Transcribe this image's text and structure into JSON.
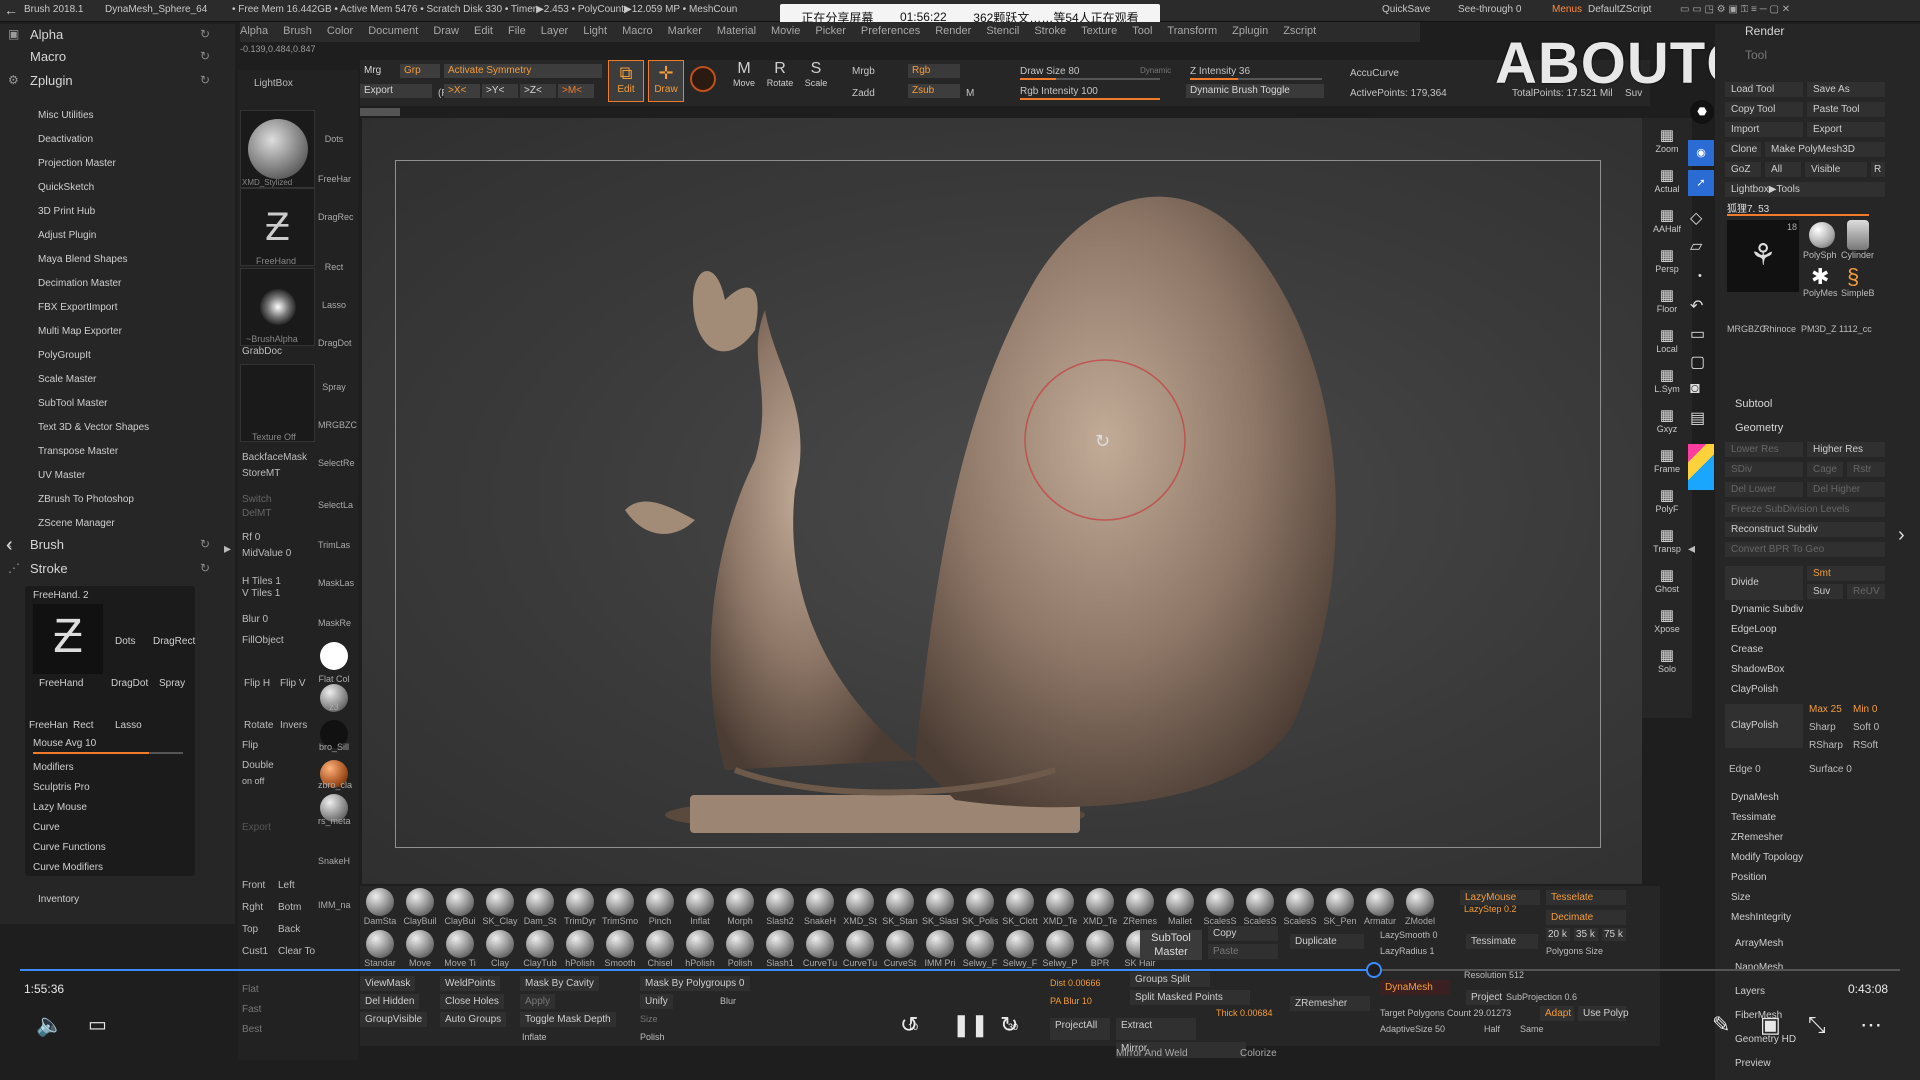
{
  "titlebar": {
    "app": "Brush 2018.1",
    "doc": "DynaMesh_Sphere_64",
    "freemem": "• Free Mem 16.442GB • Active Mem 5476 • Scratch Disk 330 • Timer▶2.453 • PolyCount▶12.059 MP • MeshCoun",
    "quicksave": "QuickSave",
    "seethrough": "See-through  0",
    "menus": "Menus",
    "defaultzscript": "DefaultZScript"
  },
  "share": {
    "label": "正在分享屏幕",
    "time": "01:56:22",
    "viewers": "362颗跃文……等54人正在观看"
  },
  "watermark": "ABOUTCG.ORG",
  "menu": [
    "Alpha",
    "Brush",
    "Color",
    "Document",
    "Draw",
    "Edit",
    "File",
    "Layer",
    "Light",
    "Macro",
    "Marker",
    "Material",
    "Movie",
    "Picker",
    "Preferences",
    "Render",
    "Stencil",
    "Stroke",
    "Texture",
    "Tool",
    "Transform",
    "Zplugin",
    "Zscript"
  ],
  "coords": "-0.139,0.484,0.847",
  "left": {
    "alpha": "Alpha",
    "macro": "Macro",
    "zplugin": "Zplugin",
    "plugins": [
      "Misc Utilities",
      "Deactivation",
      "Projection Master",
      "QuickSketch",
      "3D Print Hub",
      "Adjust Plugin",
      "Maya Blend Shapes",
      "Decimation Master",
      "FBX ExportImport",
      "Multi Map Exporter",
      "PolyGroupIt",
      "Scale Master",
      "SubTool Master",
      "Text 3D & Vector Shapes",
      "Transpose Master",
      "UV Master",
      "ZBrush To Photoshop",
      "ZScene Manager"
    ],
    "brush": "Brush",
    "stroke": "Stroke",
    "freehand": "FreeHand. 2",
    "freehand_lbl": "FreeHand",
    "dots": "Dots",
    "dragrect": "DragRect",
    "dragdot": "DragDot",
    "spray": "Spray",
    "freehan2": "FreeHan",
    "rect": "Rect",
    "lasso": "Lasso",
    "mouseavg": "Mouse Avg  10",
    "stroke_items": [
      "Modifiers",
      "Sculptris Pro",
      "Lazy Mouse",
      "Curve",
      "Curve Functions",
      "Curve Modifiers"
    ],
    "inventory": "Inventory"
  },
  "toolcol": {
    "lightbox": "LightBox",
    "xmd": "XMD_Stylized",
    "freehand": "FreeHand",
    "brushalpha": "~BrushAlpha",
    "grabdoc": "GrabDoc",
    "textureoff": "Texture Off",
    "backfacemask": "BackfaceMask",
    "storemt": "StoreMT",
    "switch": "Switch",
    "delmt": "DelMT",
    "rf": "Rf 0",
    "midvalue": "MidValue 0",
    "htiles": "H Tiles 1",
    "vtiles": "V Tiles 1",
    "blur": "Blur 0",
    "fillobject": "FillObject",
    "fliph": "Flip H",
    "flipv": "Flip V",
    "rotate": "Rotate",
    "invers": "Invers",
    "flip": "Flip",
    "double": "Double",
    "onoff": "on  off",
    "export": "Export",
    "front": "Front",
    "left": "Left",
    "rght": "Rght",
    "botm": "Botm",
    "top": "Top",
    "back": "Back",
    "cust1": "Cust1",
    "clearto": "Clear To",
    "flat": "Flat",
    "fast": "Fast",
    "best": "Best",
    "dots": "Dots",
    "freehar": "FreeHar",
    "dragrect": "DragRec",
    "rect": "Rect",
    "lasso": "Lasso",
    "dragdot": "DragDot",
    "spray": "Spray",
    "mrgbz": "MRGBZC",
    "selectre": "SelectRe",
    "selectla": "SelectLa",
    "trimlas": "TrimLas",
    "masklas": "MaskLas",
    "maskre": "MaskRe",
    "flatcol": "Flat Col",
    "z3": "z3",
    "brosill": "bro_Sill",
    "zbrocla": "zbro_cla",
    "rsmeta": "rs_meta",
    "snakeh": "SnakeH",
    "immna": "IMM_na"
  },
  "topbar": {
    "mrg": "Mrg",
    "grp": "Grp",
    "activate_symmetry": "Activate Symmetry",
    "export": "Export",
    "r": "(R)",
    "x": ">X<",
    "y": ">Y<",
    "z": ">Z<",
    "m": ">M<",
    "edit": "Edit",
    "draw": "Draw",
    "move": "Move",
    "rotate": "Rotate",
    "scale": "Scale",
    "mrgb": "Mrgb",
    "rgb": "Rgb",
    "zadd": "Zadd",
    "zsub": "Zsub",
    "m2": "M",
    "drawsize": "Draw Size 80",
    "dynamic": "Dynamic",
    "zintensity": "Z Intensity 36",
    "rgbintensity": "Rgb Intensity 100",
    "dynamic_brush": "Dynamic Brush Toggle",
    "accucurve": "AccuCurve",
    "activepoints": "ActivePoints: 179,364",
    "totalpoints": "TotalPoints: 17.521 Mil",
    "suv": "Suv"
  },
  "rightstrip": [
    "Zoom",
    "Actual",
    "AAHalf",
    "Persp",
    "Floor",
    "Local",
    "L.Sym",
    "Gxyz",
    "Frame",
    "PolyF",
    "Transp",
    "Ghost",
    "Xpose",
    "Solo"
  ],
  "right": {
    "render": "Render",
    "tool": "Tool",
    "loadtool": "Load Tool",
    "saveas": "Save As",
    "copytool": "Copy Tool",
    "pastetool": "Paste Tool",
    "import": "Import",
    "export": "Export",
    "clone": "Clone",
    "makepoly": "Make PolyMesh3D",
    "goz": "GoZ",
    "all": "All",
    "visible": "Visible",
    "r": "R",
    "lightbox_tools": "Lightbox▶Tools",
    "model": "狐狸7. 53",
    "num18": "18",
    "polysph": "PolySph",
    "cylinder": "Cylinder",
    "polymes": "PolyMes",
    "simpleb": "SimpleB",
    "mrgbz": "MRGBZC",
    "rhinoce": "Rhinoce",
    "pm3d": "PM3D_Z",
    "itm1112": "1112_cc",
    "subtool": "Subtool",
    "geometry": "Geometry",
    "lowerres": "Lower Res",
    "higherres": "Higher Res",
    "sdiv": "SDiv",
    "cage": "Cage",
    "rstr": "Rstr",
    "dellower": "Del Lower",
    "delhigher": "Del Higher",
    "freeze": "Freeze SubDivision Levels",
    "reconstruct": "Reconstruct Subdiv",
    "convert": "Convert BPR To Geo",
    "divide": "Divide",
    "smt": "Smt",
    "suv": "Suv",
    "reuv": "ReUV",
    "items": [
      "Dynamic Subdiv",
      "EdgeLoop",
      "Crease",
      "ShadowBox",
      "ClayPolish"
    ],
    "claypolish": "ClayPolish",
    "max": "Max 25",
    "min": "Min 0",
    "sharp": "Sharp",
    "soft": "Soft 0",
    "rsharp": "RSharp",
    "rsoft": "RSoft",
    "edge": "Edge 0",
    "surface": "Surface 0",
    "items2": [
      "DynaMesh",
      "Tessimate",
      "ZRemesher",
      "Modify Topology",
      "Position",
      "Size",
      "MeshIntegrity"
    ],
    "arraymesh": "ArrayMesh",
    "nanomesh": "NanoMesh",
    "layers": "Layers",
    "fibermesh": "FiberMesh",
    "geomhd": "Geometry HD",
    "preview": "Preview"
  },
  "bottom": {
    "brushes": [
      "DamSta",
      "ClayBuil",
      "ClayBui",
      "SK_Clay",
      "Dam_St",
      "TrimDyr",
      "TrimSmo",
      "Pinch",
      "Inflat",
      "Morph",
      "Slash2",
      "SnakeH",
      "XMD_St",
      "SK_Stan",
      "SK_Slast",
      "SK_Polis",
      "SK_Clott",
      "XMD_Te",
      "XMD_Te",
      "ZRemes",
      "Mallet",
      "ScalesS",
      "ScalesS",
      "ScalesS",
      "SK_Pen",
      "Armatur",
      "ZModel"
    ],
    "brushes2": [
      "Standar",
      "Move",
      "Move Ti",
      "Clay",
      "ClayTub",
      "hPolish",
      "Smooth",
      "Chisel",
      "hPolish",
      "Polish",
      "Slash1",
      "CurveTu",
      "CurveTu",
      "CurveSt",
      "IMM Pri",
      "Selwy_F",
      "Selwy_F",
      "Selwy_P",
      "BPR",
      "SK Hair"
    ],
    "subtool_master": "SubTool Master",
    "copy": "Copy",
    "paste": "Paste",
    "duplicate": "Duplicate",
    "lazymouse": "LazyMouse",
    "lazystep": "LazyStep 0.2",
    "lazysmooth": "LazySmooth 0",
    "lazyradius": "LazyRadius 1",
    "tesselate": "Tesselate",
    "decimate": "Decimate",
    "tessimate": "Tessimate",
    "v20k": "20 k",
    "v35k": "35 k",
    "v75k": "75 k",
    "polysize": "Polygons Size",
    "resolution": "Resolution 512",
    "dynamesh": "DynaMesh",
    "project": "Project",
    "subprojection": "SubProjection 0.6",
    "zremesher": "ZRemesher",
    "targetpoly": "Target Polygons Count 29.01273",
    "adapt": "Adapt",
    "usepoly": "Use Polyp",
    "adaptivesize": "AdaptiveSize 50",
    "half": "Half",
    "same": "Same",
    "viewmask": "ViewMask",
    "weldpoints": "WeldPoints",
    "maskbycavity": "Mask By Cavity",
    "maskbypoly": "Mask By Polygroups 0",
    "delhidden": "Del Hidden",
    "closeholes": "Close Holes",
    "apply": "Apply",
    "unify": "Unify",
    "groupvisible": "GroupVisible",
    "autogroups": "Auto Groups",
    "togglemask": "Toggle Mask Depth",
    "inflate": "Inflate",
    "polish": "Polish",
    "size": "Size",
    "blur": "Blur",
    "dist": "Dist 0.00666",
    "pablur": "PA Blur 10",
    "groupssplit": "Groups Split",
    "splitmasked": "Split Masked Points",
    "thick": "Thick 0.00684",
    "extract": "Extract",
    "mirror": "Mirror",
    "mirrorweld": "Mirror And Weld",
    "colorize": "Colorize",
    "projectall": "ProjectAll"
  },
  "player": {
    "elapsed": "1:55:36",
    "total": "0:43:08",
    "rewind": "10",
    "forward": "30",
    "progress": 0.72
  }
}
